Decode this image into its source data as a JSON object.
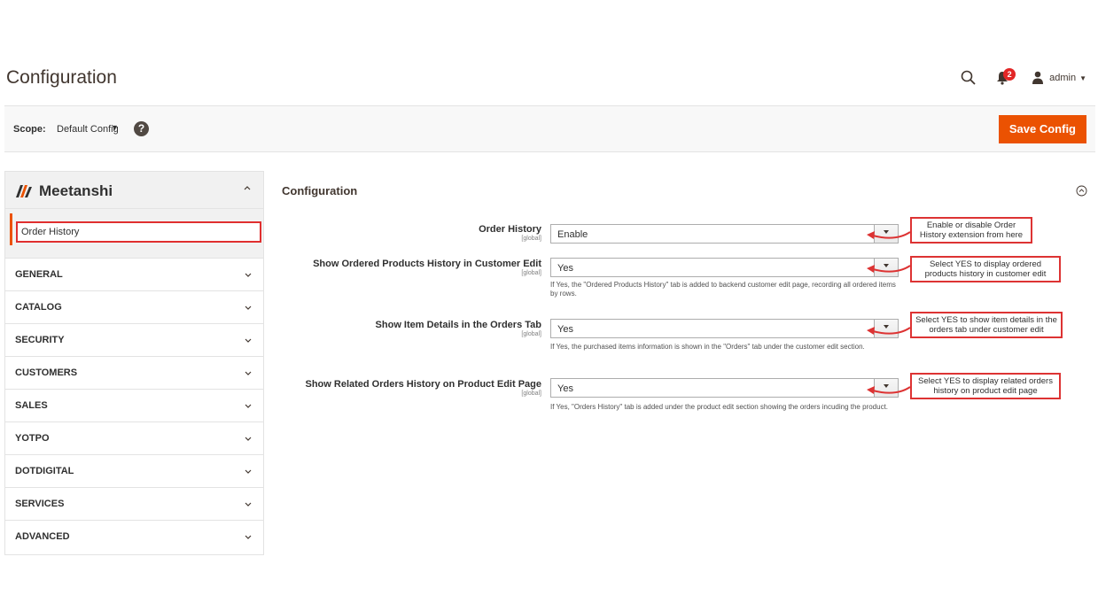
{
  "header": {
    "title": "Configuration",
    "notifications_count": "2",
    "user_label": "admin"
  },
  "scope": {
    "label": "Scope:",
    "value": "Default Config",
    "help": "?"
  },
  "toolbar": {
    "save_label": "Save Config"
  },
  "sidebar": {
    "brand": "Meetanshi",
    "sub_item": "Order History",
    "items": [
      {
        "label": "GENERAL"
      },
      {
        "label": "CATALOG"
      },
      {
        "label": "SECURITY"
      },
      {
        "label": "CUSTOMERS"
      },
      {
        "label": "SALES"
      },
      {
        "label": "YOTPO"
      },
      {
        "label": "DOTDIGITAL"
      },
      {
        "label": "SERVICES"
      },
      {
        "label": "ADVANCED"
      }
    ]
  },
  "section": {
    "title": "Configuration"
  },
  "fields": [
    {
      "label": "Order History",
      "scope": "[global]",
      "value": "Enable",
      "note": ""
    },
    {
      "label": "Show Ordered Products History in Customer Edit",
      "scope": "[global]",
      "value": "Yes",
      "note": "If Yes, the \"Ordered Products History\" tab is added to backend customer edit page, recording all ordered items by rows."
    },
    {
      "label": "Show Item Details in the Orders Tab",
      "scope": "[global]",
      "value": "Yes",
      "note": "If Yes, the purchased items information is shown in the \"Orders\" tab under the customer edit section."
    },
    {
      "label": "Show Related Orders History on Product Edit Page",
      "scope": "[global]",
      "value": "Yes",
      "note": "If Yes, \"Orders History\" tab is added under the product edit section showing the orders incuding the product."
    }
  ],
  "callouts": [
    "Enable or disable Order History extension from here",
    "Select YES to display ordered products history in customer edit",
    "Select YES to show item details in the orders tab under customer edit",
    "Select YES to display related orders history on product edit page"
  ],
  "colors": {
    "accent": "#eb5202",
    "callout_border": "#dd3333",
    "badge": "#e22626"
  }
}
